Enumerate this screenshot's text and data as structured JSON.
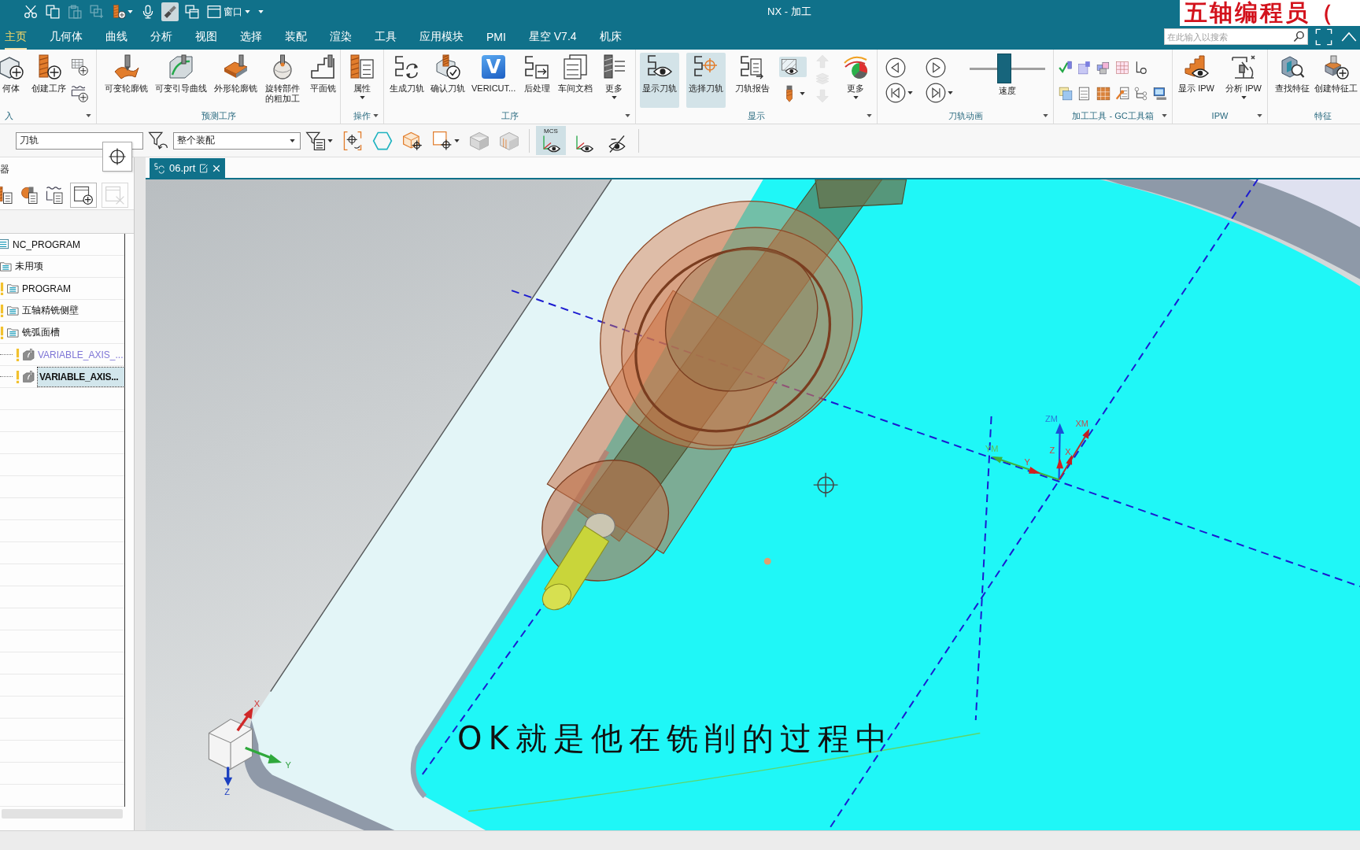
{
  "title_bar": {
    "quick_access": [
      {
        "on": false,
        "disabled": false,
        "menu": false
      },
      {
        "on": false,
        "disabled": false,
        "menu": false
      },
      {
        "on": false,
        "disabled": true,
        "menu": false
      },
      {
        "on": false,
        "disabled": true,
        "menu": false
      },
      {
        "on": false,
        "disabled": false,
        "menu": true
      },
      {
        "on": false,
        "disabled": false,
        "menu": false
      },
      {
        "on": true,
        "disabled": false,
        "menu": false
      },
      {
        "on": false,
        "disabled": false,
        "menu": false
      }
    ],
    "window_menu": {
      "label": "窗口"
    },
    "title": "NX - 加工"
  },
  "channel_banner": "五轴编程员（",
  "menu_tabs": [
    {
      "label": "主页",
      "selected": true
    },
    {
      "label": "几何体",
      "selected": false
    },
    {
      "label": "曲线",
      "selected": false
    },
    {
      "label": "分析",
      "selected": false
    },
    {
      "label": "视图",
      "selected": false
    },
    {
      "label": "选择",
      "selected": false
    },
    {
      "label": "装配",
      "selected": false
    },
    {
      "label": "渲染",
      "selected": false
    },
    {
      "label": "工具",
      "selected": false
    },
    {
      "label": "应用模块",
      "selected": false
    },
    {
      "label": "PMI",
      "selected": false
    },
    {
      "label": "星空 V7.4",
      "selected": false
    },
    {
      "label": "机床",
      "selected": false
    }
  ],
  "search": {
    "placeholder": "在此输入以搜索"
  },
  "ribbon": {
    "groups": [
      {
        "label": "入",
        "menu": true,
        "items": [
          {
            "kind": "large",
            "label": "何体",
            "on": false,
            "menu": false
          },
          {
            "kind": "large",
            "label": "创建工序",
            "on": false,
            "menu": false
          },
          {
            "kind": "column",
            "buttons": [
              {
                "on": false,
                "disabled": false,
                "menu": false
              },
              {
                "on": false,
                "disabled": false,
                "menu": false
              }
            ]
          }
        ]
      },
      {
        "label": "预测工序",
        "menu": false,
        "items": [
          {
            "kind": "large",
            "label": "可变轮廓铣",
            "on": false,
            "menu": false
          },
          {
            "kind": "large",
            "label": "可变引导曲线",
            "on": false,
            "menu": false
          },
          {
            "kind": "large",
            "label": "外形轮廓铣",
            "on": false,
            "menu": false
          },
          {
            "kind": "large",
            "label": "旋转部件的粗加工",
            "on": false,
            "menu": false
          },
          {
            "kind": "large",
            "label": "平面铣",
            "on": false,
            "menu": false
          }
        ]
      },
      {
        "label": "操作",
        "menu": true,
        "items": [
          {
            "kind": "large",
            "label": "属性",
            "on": false,
            "menu": true
          }
        ]
      },
      {
        "label": "工序",
        "menu": true,
        "items": [
          {
            "kind": "large",
            "label": "生成刀轨",
            "on": false,
            "menu": false
          },
          {
            "kind": "large",
            "label": "确认刀轨",
            "on": false,
            "menu": false
          },
          {
            "kind": "logo",
            "label": "VERICUT...",
            "logo": "V",
            "on": false,
            "menu": false
          },
          {
            "kind": "large",
            "label": "后处理",
            "on": false,
            "menu": false
          },
          {
            "kind": "large",
            "label": "车间文档",
            "on": false,
            "menu": false
          },
          {
            "kind": "large",
            "label": "更多",
            "on": false,
            "menu": true
          }
        ]
      },
      {
        "label": "显示",
        "menu": true,
        "items": [
          {
            "kind": "large",
            "label": "显示刀轨",
            "on": true,
            "menu": false
          },
          {
            "kind": "large",
            "label": "选择刀轨",
            "on": true,
            "menu": false
          },
          {
            "kind": "large",
            "label": "刀轨报告",
            "on": false,
            "menu": false
          },
          {
            "kind": "column",
            "buttons": [
              {
                "on": true,
                "disabled": false,
                "menu": false
              },
              {
                "on": false,
                "disabled": false,
                "menu": true
              }
            ]
          },
          {
            "kind": "column",
            "buttons": [
              {
                "on": false,
                "disabled": true,
                "menu": false
              },
              {
                "on": false,
                "disabled": true,
                "menu": false
              },
              {
                "on": false,
                "disabled": true,
                "menu": false
              }
            ]
          },
          {
            "kind": "large",
            "label": "更多",
            "on": false,
            "menu": true
          }
        ]
      },
      {
        "label": "刀轨动画",
        "menu": true,
        "items": [
          {
            "kind": "player",
            "buttons": [
              {
                "on": false,
                "disabled": false,
                "menu": false
              },
              {
                "on": false,
                "disabled": false,
                "menu": false
              },
              {
                "on": false,
                "disabled": false,
                "menu": true
              },
              {
                "on": false,
                "disabled": false,
                "menu": true
              }
            ]
          },
          {
            "kind": "slider",
            "label": "速度",
            "level": 0.45
          }
        ]
      },
      {
        "label": "加工工具 - GC工具箱",
        "menu": true,
        "items": [
          {
            "kind": "rows",
            "rows": [
              {
                "buttons": [
                  {
                    "on": false,
                    "disabled": false
                  },
                  {
                    "on": false,
                    "disabled": false
                  },
                  {
                    "on": false,
                    "disabled": false
                  },
                  {
                    "on": false,
                    "disabled": false
                  },
                  {
                    "on": false,
                    "disabled": false
                  }
                ]
              },
              {
                "buttons": [
                  {
                    "on": false,
                    "disabled": false
                  },
                  {
                    "on": false,
                    "disabled": false
                  },
                  {
                    "on": false,
                    "disabled": false
                  },
                  {
                    "on": false,
                    "disabled": false
                  },
                  {
                    "on": false,
                    "disabled": false
                  },
                  {
                    "on": false,
                    "disabled": false
                  }
                ]
              }
            ]
          }
        ]
      },
      {
        "label": "IPW",
        "menu": true,
        "items": [
          {
            "kind": "large",
            "label": "显示 IPW",
            "on": false,
            "menu": false
          },
          {
            "kind": "large",
            "label": "分析 IPW",
            "on": false,
            "menu": true
          }
        ]
      },
      {
        "label": "特征",
        "menu": false,
        "items": [
          {
            "kind": "large",
            "label": "查找特征",
            "on": false,
            "menu": false
          },
          {
            "kind": "large",
            "label": "创建特征工",
            "on": false,
            "menu": false
          }
        ]
      }
    ]
  },
  "selection_bar": {
    "items": [
      {
        "kind": "dropdown",
        "value": "刀轨",
        "menu": false
      },
      {
        "kind": "tool",
        "on": false,
        "menu": false
      },
      {
        "kind": "dropdown",
        "value": "整个装配",
        "menu": true
      },
      {
        "kind": "tool",
        "on": false,
        "menu": true
      },
      {
        "kind": "tool",
        "on": false,
        "menu": false
      },
      {
        "kind": "tool",
        "on": false,
        "menu": false
      },
      {
        "kind": "tool",
        "on": false,
        "menu": false
      },
      {
        "kind": "tool",
        "on": false,
        "menu": true
      },
      {
        "kind": "tool",
        "on": false,
        "menu": false
      },
      {
        "kind": "tool",
        "on": false,
        "menu": false
      }
    ],
    "view_toggles": [
      {
        "label": "MCS",
        "on": true
      },
      {
        "on": false
      },
      {
        "on": false
      }
    ]
  },
  "snap_button": {
    "on": false
  },
  "navigator": {
    "title": "器",
    "tools": [
      {
        "kind": "icon",
        "disabled": false
      },
      {
        "kind": "icon",
        "disabled": false
      },
      {
        "kind": "icon",
        "disabled": false
      },
      {
        "kind": "boxed",
        "disabled": false
      },
      {
        "kind": "boxed",
        "disabled": true
      }
    ],
    "tree": [
      {
        "label": "NC_PROGRAM",
        "warning": false,
        "selected": false,
        "children": [
          {
            "label": "未用项",
            "warning": false,
            "selected": false
          },
          {
            "label": "PROGRAM",
            "warning": true,
            "selected": false
          },
          {
            "label": "五轴精铣侧壁",
            "warning": true,
            "selected": false
          },
          {
            "label": "铣弧面槽",
            "warning": true,
            "selected": false,
            "children": [
              {
                "label": "VARIABLE_AXIS_...",
                "warning": true,
                "selected": false,
                "color": "#7f76d6"
              },
              {
                "label": "VARIABLE_AXIS...",
                "warning": true,
                "selected": true
              }
            ]
          }
        ]
      }
    ]
  },
  "document_tab": {
    "label": "06.prt"
  },
  "viewport": {
    "mcs_axes": {
      "zm": "ZM",
      "xm": "XM",
      "ym": "YM",
      "z": "Z",
      "x": "X",
      "y": "Y"
    },
    "view_triad": {
      "x": "X",
      "y": "Y",
      "z": "Z"
    },
    "subtitle": "OK就是他在铣削的过程中"
  }
}
